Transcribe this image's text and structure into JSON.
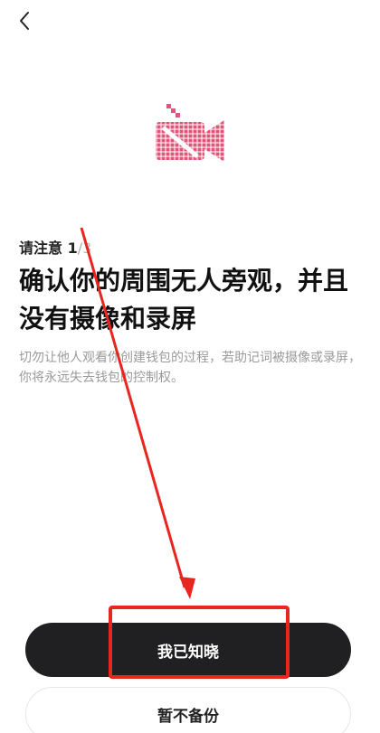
{
  "icons": {
    "back": "chevron-left-icon",
    "illustration": "camera-off-icon"
  },
  "notice": {
    "label": "请注意",
    "current_step": "1",
    "separator": "/",
    "total_steps": "3"
  },
  "headline": "确认你的周围无人旁观，并且没有摄像和录屏",
  "description": "切勿让他人观看你创建钱包的过程，若助记词被摄像或录屏，你将永远失去钱包的控制权。",
  "actions": {
    "confirm_label": "我已知晓",
    "skip_label": "暂不备份"
  },
  "colors": {
    "illustration_pink": "#e0557a",
    "primary_button": "#202022",
    "annotation_red": "#e8261f",
    "description_text": "#9a9a9a"
  }
}
